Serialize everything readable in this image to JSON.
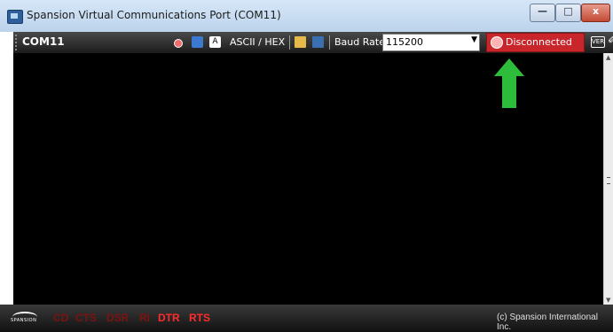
{
  "window": {
    "title": "Spansion Virtual Communications Port (COM11)"
  },
  "titlebar_buttons": {
    "minimize": "—",
    "maximize": "□",
    "close": "x"
  },
  "toolbar": {
    "port": "COM11",
    "ascii_hex": "ASCII / HEX",
    "baud_label": "Baud Rate:",
    "baud_value": "115200",
    "connection_status": "Disconnected",
    "connection_color": "#c9262c",
    "icons": [
      "status-dot-icon",
      "user-icon",
      "font-a-icon",
      "folder-icon",
      "save-icon",
      "disconnected-icon",
      "version-icon",
      "wrench-icon"
    ]
  },
  "terminal": {
    "content": ""
  },
  "statusbar": {
    "logo_text": "SPANSION",
    "signals": [
      {
        "label": "CD",
        "state": "off"
      },
      {
        "label": "CTS",
        "state": "off"
      },
      {
        "label": "DSR",
        "state": "off"
      },
      {
        "label": "RI",
        "state": "off"
      },
      {
        "label": "DTR",
        "state": "on"
      },
      {
        "label": "RTS",
        "state": "on"
      }
    ],
    "copyright": "(c) Spansion International Inc."
  },
  "annotation": {
    "arrow_color": "#2ebd3a"
  }
}
